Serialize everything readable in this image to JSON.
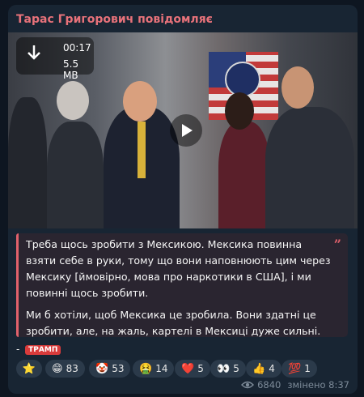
{
  "message": {
    "channel_name": "Тарас Григорович повідомляє",
    "video": {
      "duration": "00:17",
      "size": "5.5 MB",
      "download_icon": "download-arrow-icon",
      "play_icon": "play-icon"
    },
    "quote": {
      "paragraph1": "Треба щось зробити з Мексикою. Мексика повинна взяти себе в руки, тому що вони наповнюють цим через Мексику [ймовірно, мова про наркотики в США], і ми повинні щось зробити.",
      "paragraph2": "Ми б хотіли, щоб Мексика це зробила. Вони здатні це зробити, але, на жаль, картелі в Мексиці дуже сильні.",
      "quote_mark": "”"
    },
    "signature": {
      "prefix": "- ",
      "tag": "ТРАМП"
    },
    "reactions": [
      {
        "emoji": "⭐",
        "count": ""
      },
      {
        "emoji": "😁",
        "count": "83"
      },
      {
        "emoji": "🤡",
        "count": "53"
      },
      {
        "emoji": "🤮",
        "count": "14"
      },
      {
        "emoji": "❤️",
        "count": "5"
      },
      {
        "emoji": "👀",
        "count": "5"
      },
      {
        "emoji": "👍",
        "count": "4"
      },
      {
        "emoji": "💯",
        "count": "1"
      }
    ],
    "views": "6840",
    "edited_label": "змінено 8:37"
  },
  "colors": {
    "background": "#0e1621",
    "bubble": "#182533",
    "channel_name": "#e8727a",
    "quote_accent": "#e0616b",
    "tag": "#d83b3b"
  }
}
